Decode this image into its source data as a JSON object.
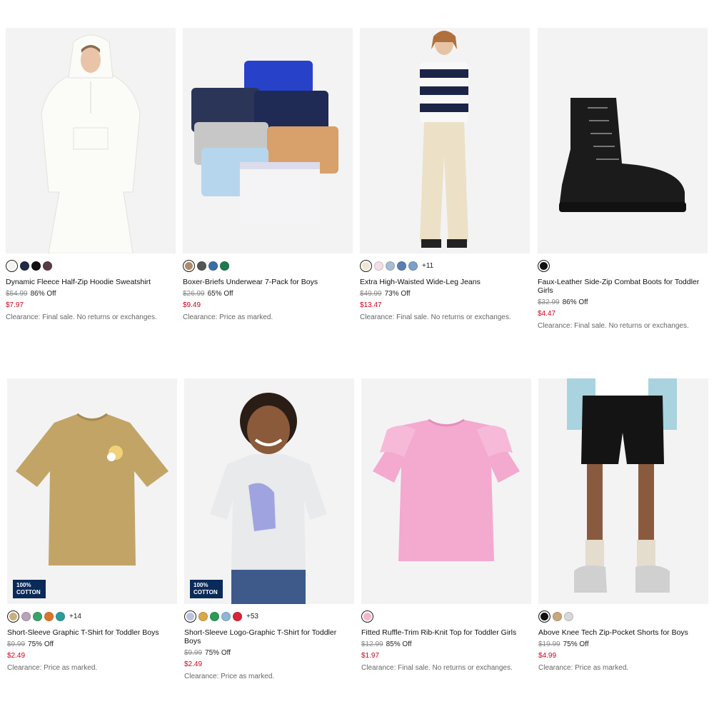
{
  "products": [
    {
      "name": "Dynamic Fleece Half-Zip Hoodie Sweatshirt",
      "original_price": "$54.99",
      "discount": "86% Off",
      "sale_price": "$7.97",
      "note": "Clearance: Final sale. No returns or exchanges.",
      "swatches": [
        "#f4f4f0",
        "#1f2a44",
        "#111111",
        "#5b3a44"
      ],
      "more": "",
      "badge": ""
    },
    {
      "name": "Boxer-Briefs Underwear 7-Pack for Boys",
      "original_price": "$26.99",
      "discount": "65% Off",
      "sale_price": "$9.49",
      "note": "Clearance: Price as marked.",
      "swatches": [
        "#b08a6a",
        "#555555",
        "#3a6ea5",
        "#1f7a4d"
      ],
      "more": "",
      "badge": ""
    },
    {
      "name": "Extra High-Waisted Wide-Leg Jeans",
      "original_price": "$49.99",
      "discount": "73% Off",
      "sale_price": "$13.47",
      "note": "Clearance: Final sale. No returns or exchanges.",
      "swatches": [
        "#efe6cf",
        "#f3dfe6",
        "#a9bcd3",
        "#5b7fb3",
        "#7c9ec9"
      ],
      "more": "+11",
      "badge": ""
    },
    {
      "name": "Faux-Leather Side-Zip Combat Boots for Toddler Girls",
      "original_price": "$32.99",
      "discount": "86% Off",
      "sale_price": "$4.47",
      "note": "Clearance: Final sale. No returns or exchanges.",
      "swatches": [
        "#111111"
      ],
      "more": "",
      "badge": ""
    },
    {
      "name": "Short-Sleeve Graphic T-Shirt for Toddler Boys",
      "original_price": "$9.99",
      "discount": "75% Off",
      "sale_price": "$2.49",
      "note": "Clearance: Price as marked.",
      "swatches": [
        "#c8b07a",
        "#b9a3b8",
        "#3aa36a",
        "#d9762a",
        "#2a9d9a"
      ],
      "more": "+14",
      "badge": "100% COTTON"
    },
    {
      "name": "Short-Sleeve Logo-Graphic T-Shirt for Toddler Boys",
      "original_price": "$9.99",
      "discount": "75% Off",
      "sale_price": "$2.49",
      "note": "Clearance: Price as marked.",
      "swatches": [
        "#b9c2de",
        "#d8a84a",
        "#2e9a57",
        "#8fb6d6",
        "#d6263a"
      ],
      "more": "+53",
      "badge": "100% COTTON"
    },
    {
      "name": "Fitted Ruffle-Trim Rib-Knit Top for Toddler Girls",
      "original_price": "$12.99",
      "discount": "85% Off",
      "sale_price": "$1.97",
      "note": "Clearance: Final sale. No returns or exchanges.",
      "swatches": [
        "#f4b6cf"
      ],
      "more": "",
      "badge": ""
    },
    {
      "name": "Above Knee Tech Zip-Pocket Shorts for Boys",
      "original_price": "$19.99",
      "discount": "75% Off",
      "sale_price": "$4.99",
      "note": "Clearance: Price as marked.",
      "swatches": [
        "#111111",
        "#c9a77a",
        "#d8d8d8"
      ],
      "more": "",
      "badge": ""
    }
  ]
}
